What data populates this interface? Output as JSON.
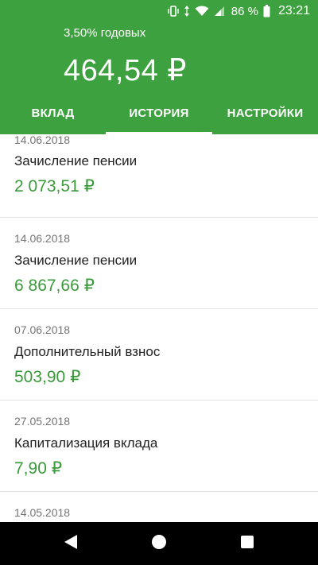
{
  "status_bar": {
    "battery_percent": "86 %",
    "time": "23:21",
    "icons": [
      "vibrate-icon",
      "data-arrows-icon",
      "wifi-icon",
      "signal-icon",
      "battery-icon"
    ]
  },
  "header": {
    "rate": "3,50% годовых",
    "balance": "464,54 ₽",
    "accent_color": "#3ea13f"
  },
  "tabs": [
    {
      "label": "ВКЛАД",
      "active": false
    },
    {
      "label": "ИСТОРИЯ",
      "active": true
    },
    {
      "label": "НАСТРОЙКИ",
      "active": false
    }
  ],
  "transactions": [
    {
      "date": "14.06.2018",
      "title": "Зачисление пенсии",
      "amount": "2 073,51 ₽"
    },
    {
      "date": "14.06.2018",
      "title": "Зачисление пенсии",
      "amount": "6 867,66 ₽"
    },
    {
      "date": "07.06.2018",
      "title": "Дополнительный взнос",
      "amount": "503,90 ₽"
    },
    {
      "date": "27.05.2018",
      "title": "Капитализация вклада",
      "amount": "7,90 ₽"
    },
    {
      "date": "14.05.2018",
      "title": "",
      "amount": ""
    }
  ],
  "nav_bar": {
    "buttons": [
      "back-icon",
      "home-icon",
      "recents-icon"
    ]
  }
}
